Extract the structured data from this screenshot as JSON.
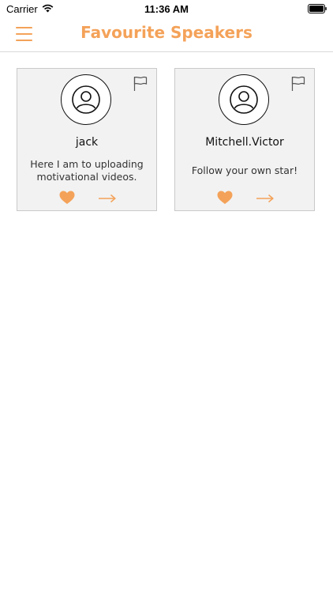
{
  "status_bar": {
    "carrier": "Carrier",
    "time": "11:36 AM"
  },
  "header": {
    "title": "Favourite Speakers"
  },
  "speakers": [
    {
      "name": "jack",
      "bio": "Here I am to uploading motivational videos."
    },
    {
      "name": "Mitchell.Victor",
      "bio": "Follow your own star!"
    }
  ],
  "colors": {
    "accent": "#f4a259",
    "card_bg": "#f2f2f2",
    "card_border": "#c9c9c9"
  },
  "icons": [
    "menu-icon",
    "user-icon",
    "flag-icon",
    "heart-icon",
    "arrow-right-icon"
  ]
}
